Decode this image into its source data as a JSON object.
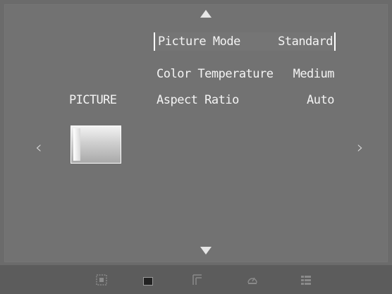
{
  "menu": {
    "category": "PICTURE",
    "items": [
      {
        "label": "Picture Mode",
        "value": "Standard",
        "selected": true
      },
      {
        "label": "Color Temperature",
        "value": "Medium",
        "selected": false
      },
      {
        "label": "Aspect Ratio",
        "value": "Auto",
        "selected": false
      }
    ]
  },
  "icons": {
    "up": "triangle-up-icon",
    "down": "triangle-down-icon",
    "left": "chevron-left-icon",
    "right": "chevron-right-icon",
    "bottom": [
      "settings-grid-icon",
      "square-icon",
      "corner-icon",
      "gauge-icon",
      "list-icon"
    ]
  },
  "colors": {
    "background": "#6b6b6b",
    "text": "#f4f4f4",
    "bottom_bar": "#5c5c5c"
  }
}
